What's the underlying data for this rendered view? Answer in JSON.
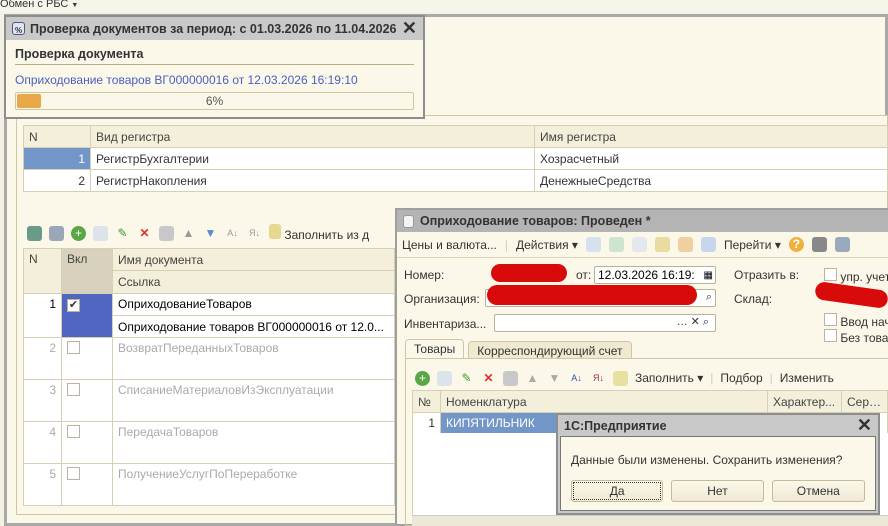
{
  "topbar": {
    "label": "Обмен с РБС"
  },
  "progress": {
    "title": "Проверка документов за период: с  01.03.2026 по 11.04.2026",
    "heading": "Проверка документа",
    "document": "Оприходование товаров ВГ000000016 от 12.03.2026 16:19:10",
    "percent_label": "6%",
    "percent": 6
  },
  "registers": {
    "headers": [
      "N",
      "Вид регистра",
      "Имя регистра"
    ],
    "rows": [
      [
        "1",
        "РегистрБухгалтерии",
        "Хозрасчетный"
      ],
      [
        "2",
        "РегистрНакопления",
        "ДенежныеСредства"
      ]
    ]
  },
  "docs_toolbar": {
    "fill_label": "Заполнить из д"
  },
  "docs": {
    "headers": {
      "n": "N",
      "on": "Вкл",
      "name": "Имя документа",
      "ref": "Ссылка"
    },
    "rows": [
      {
        "n": "1",
        "checked": true,
        "name": "ОприходованиеТоваров",
        "ref": "Оприходование товаров ВГ000000016 от 12.0..."
      },
      {
        "n": "2",
        "checked": false,
        "name": "ВозвратПереданныхТоваров",
        "ref": ""
      },
      {
        "n": "3",
        "checked": false,
        "name": "СписаниеМатериаловИзЭксплуатации",
        "ref": ""
      },
      {
        "n": "4",
        "checked": false,
        "name": "ПередачаТоваров",
        "ref": ""
      },
      {
        "n": "5",
        "checked": false,
        "name": "ПолучениеУслугПоПереработке",
        "ref": ""
      }
    ]
  },
  "docwin": {
    "title": "Оприходование товаров: Проведен *",
    "menu": {
      "prices": "Цены и валюта...",
      "actions": "Действия",
      "goto": "Перейти"
    },
    "labels": {
      "number": "Номер:",
      "from": "от:",
      "org": "Организация:",
      "inv": "Инвентариза...",
      "reflect": "Отразить в:",
      "warehouse": "Склад:"
    },
    "date_value": "12.03.2026 16:19:",
    "checks": {
      "upr": "упр. учет",
      "vvod": "Ввод нач",
      "bez": "Без това"
    },
    "tabs": [
      "Товары",
      "Корреспондирующий счет"
    ],
    "toolbar": {
      "fill": "Заполнить",
      "select": "Подбор",
      "change": "Изменить"
    },
    "table": {
      "headers": [
        "№",
        "Номенклатура",
        "Характер...",
        "Серия"
      ],
      "rows": [
        [
          "1",
          "КИПЯТИЛЬНИК"
        ]
      ]
    }
  },
  "modal": {
    "title": "1С:Предприятие",
    "message": "Данные были изменены. Сохранить изменения?",
    "yes": "Да",
    "no": "Нет",
    "cancel": "Отмена"
  }
}
